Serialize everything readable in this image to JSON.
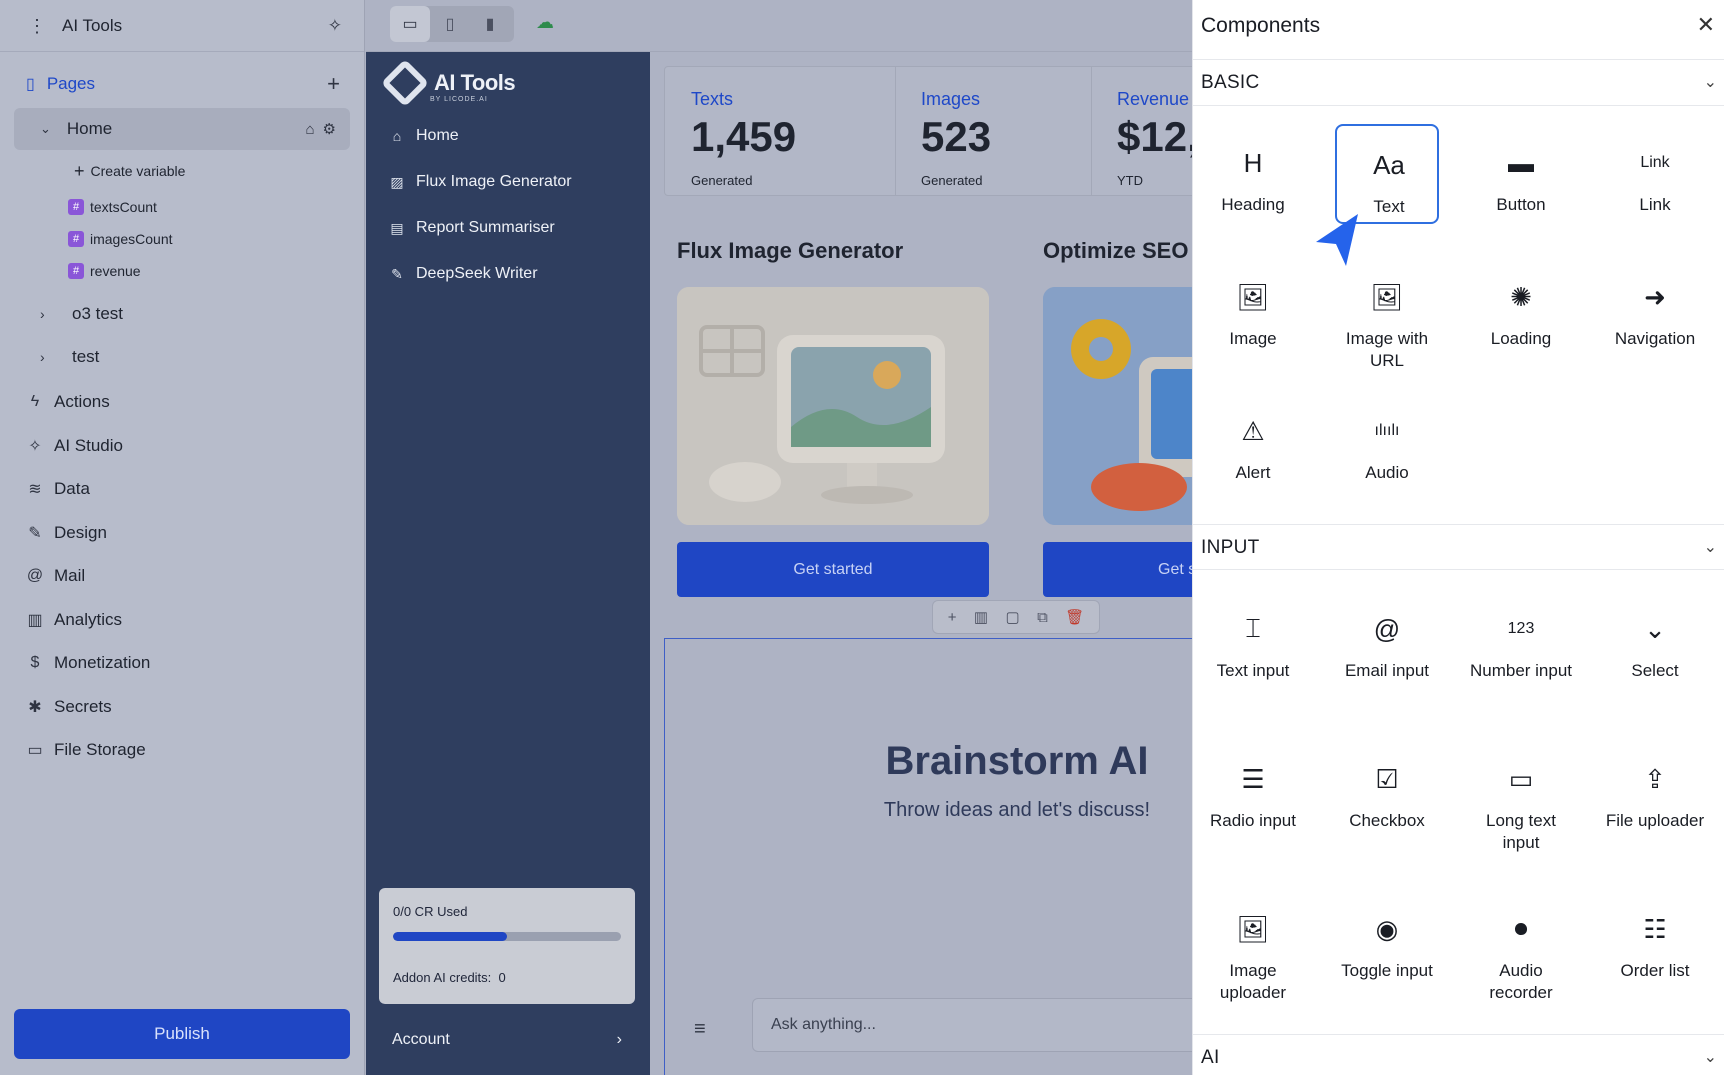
{
  "editor": {
    "project_title": "AI Tools",
    "pages_label": "Pages",
    "home_page": "Home",
    "create_variable": "Create variable",
    "variables": [
      "textsCount",
      "imagesCount",
      "revenue"
    ],
    "other_pages": [
      "o3 test",
      "test"
    ],
    "nav": [
      {
        "label": "Actions",
        "icon": "bolt-icon",
        "glyph": "ϟ"
      },
      {
        "label": "AI Studio",
        "icon": "sparkle-icon",
        "glyph": "✧"
      },
      {
        "label": "Data",
        "icon": "database-icon",
        "glyph": "≋"
      },
      {
        "label": "Design",
        "icon": "brush-icon",
        "glyph": "✎"
      },
      {
        "label": "Mail",
        "icon": "at-icon",
        "glyph": "@"
      },
      {
        "label": "Analytics",
        "icon": "chart-icon",
        "glyph": "▥"
      },
      {
        "label": "Monetization",
        "icon": "dollar-icon",
        "glyph": "$"
      },
      {
        "label": "Secrets",
        "icon": "asterisk-icon",
        "glyph": "✱"
      },
      {
        "label": "File Storage",
        "icon": "folder-icon",
        "glyph": "▭"
      }
    ],
    "publish_label": "Publish"
  },
  "app": {
    "logo_text": "AI Tools",
    "logo_sub": "BY LICODE.AI",
    "nav": [
      {
        "label": "Home",
        "icon": "home-icon",
        "glyph": "⌂"
      },
      {
        "label": "Flux Image Generator",
        "icon": "image-icon",
        "glyph": "▨"
      },
      {
        "label": "Report Summariser",
        "icon": "document-icon",
        "glyph": "▤"
      },
      {
        "label": "DeepSeek Writer",
        "icon": "pen-icon",
        "glyph": "✎"
      }
    ],
    "credits_used": "0/0 CR Used",
    "credits_progress": 0.5,
    "addon_label": "Addon AI credits:",
    "addon_value": "0",
    "account_label": "Account",
    "stats": [
      {
        "label": "Texts",
        "value": "1,459",
        "sub": "Generated"
      },
      {
        "label": "Images",
        "value": "523",
        "sub": "Generated"
      },
      {
        "label": "Revenue",
        "value": "$12,",
        "sub": "YTD"
      }
    ],
    "cards": [
      {
        "title": "Flux Image Generator",
        "button": "Get started"
      },
      {
        "title": "Optimize SEO p",
        "button": "Get s"
      }
    ],
    "brainstorm_title": "Brainstorm AI",
    "brainstorm_sub": "Throw ideas and let's discuss!",
    "ask_placeholder": "Ask anything..."
  },
  "panel": {
    "title": "Components",
    "basic_label": "BASIC",
    "input_label": "INPUT",
    "ai_label": "AI",
    "basic": [
      {
        "label": "Heading",
        "icon": "heading-icon",
        "glyph": "H"
      },
      {
        "label": "Text",
        "icon": "text-icon",
        "glyph": "Aa"
      },
      {
        "label": "Button",
        "icon": "button-icon",
        "glyph": "▬"
      },
      {
        "label": "Link",
        "icon": "link-icon",
        "glyph": "Link"
      },
      {
        "label": "Image",
        "icon": "image-icon",
        "glyph": "🖼"
      },
      {
        "label": "Image with URL",
        "icon": "image-url-icon",
        "glyph": "🖼"
      },
      {
        "label": "Loading",
        "icon": "loading-icon",
        "glyph": "✺"
      },
      {
        "label": "Navigation",
        "icon": "navigation-icon",
        "glyph": "➜"
      },
      {
        "label": "Alert",
        "icon": "alert-icon",
        "glyph": "⚠"
      },
      {
        "label": "Audio",
        "icon": "audio-icon",
        "glyph": "ılıılı"
      }
    ],
    "input": [
      {
        "label": "Text input",
        "icon": "text-input-icon",
        "glyph": "⌶"
      },
      {
        "label": "Email input",
        "icon": "email-icon",
        "glyph": "@"
      },
      {
        "label": "Number input",
        "icon": "number-icon",
        "glyph": "123"
      },
      {
        "label": "Select",
        "icon": "select-icon",
        "glyph": "⌄"
      },
      {
        "label": "Radio input",
        "icon": "radio-icon",
        "glyph": "☰"
      },
      {
        "label": "Checkbox",
        "icon": "checkbox-icon",
        "glyph": "☑"
      },
      {
        "label": "Long text input",
        "icon": "long-text-icon",
        "glyph": "▭"
      },
      {
        "label": "File uploader",
        "icon": "upload-icon",
        "glyph": "⇪"
      },
      {
        "label": "Image uploader",
        "icon": "image-upload-icon",
        "glyph": "🖼"
      },
      {
        "label": "Toggle input",
        "icon": "toggle-icon",
        "glyph": "◉"
      },
      {
        "label": "Audio recorder",
        "icon": "record-icon",
        "glyph": "⏺"
      },
      {
        "label": "Order list",
        "icon": "order-list-icon",
        "glyph": "☷"
      }
    ],
    "selected": "Text"
  },
  "colors": {
    "accent": "#1f46c4",
    "selection": "#2f6fe0",
    "variable": "#8a56d8",
    "app_sidebar": "#2f3e5f"
  }
}
